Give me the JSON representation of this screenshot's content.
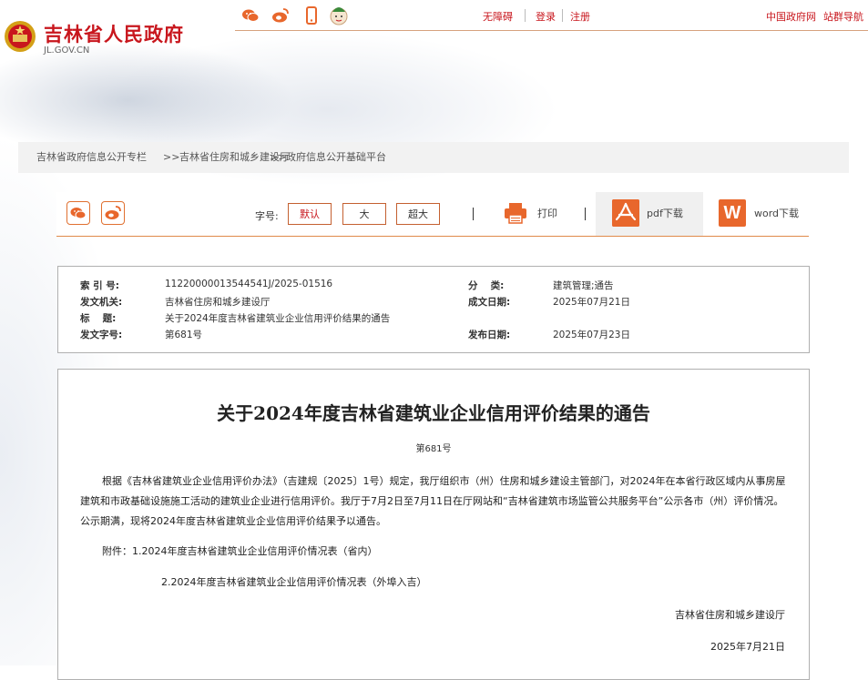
{
  "header": {
    "site_title": "吉林省人民政府",
    "site_domain": "JL.GOV.CN",
    "links": {
      "accessibility": "无障碍",
      "login": "登录",
      "register": "注册",
      "central_gov": "中国政府网",
      "site_group": "站群导航"
    }
  },
  "breadcrumb": {
    "items": [
      "吉林省政府信息公开专栏",
      "吉林省住房和城乡建设厅",
      "政府信息公开基础平台"
    ],
    "separator": ">>"
  },
  "toolbar": {
    "font_size_label": "字号:",
    "font_default": "默认",
    "font_large": "大",
    "font_xlarge": "超大",
    "print_label": "打印",
    "pdf_label": "pdf下载",
    "word_label": "word下载",
    "word_letter": "W"
  },
  "meta": {
    "index_label": "索 引 号:",
    "index_value": "11220000013544541J/2025-01516",
    "category_label": "分　 类:",
    "category_value": "建筑管理;通告",
    "issuer_label": "发文机关:",
    "issuer_value": "吉林省住房和城乡建设厅",
    "created_label": "成文日期:",
    "created_value": "2025年07月21日",
    "title_label": "标　 题:",
    "title_value": "关于2024年度吉林省建筑业企业信用评价结果的通告",
    "docno_label": "发文字号:",
    "docno_value": "第681号",
    "published_label": "发布日期:",
    "published_value": "2025年07月23日"
  },
  "article": {
    "title": "关于2024年度吉林省建筑业企业信用评价结果的通告",
    "number": "第681号",
    "body": "根据《吉林省建筑业企业信用评价办法》（吉建规〔2025〕1号）规定，我厅组织市（州）住房和城乡建设主管部门，对2024年在本省行政区域内从事房屋建筑和市政基础设施施工活动的建筑业企业进行信用评价。我厅于7月2日至7月11日在厅网站和“吉林省建筑市场监管公共服务平台”公示各市（州）评价情况。公示期满，现将2024年度吉林省建筑业企业信用评价结果予以通告。",
    "attachment_1": "附件：1.2024年度吉林省建筑业企业信用评价情况表（省内）",
    "attachment_2": "2.2024年度吉林省建筑业企业信用评价情况表（外埠入吉）",
    "signature": "吉林省住房和城乡建设厅",
    "date": "2025年7月21日"
  },
  "colors": {
    "brand_red": "#c8161d",
    "accent_orange": "#e8672c"
  }
}
